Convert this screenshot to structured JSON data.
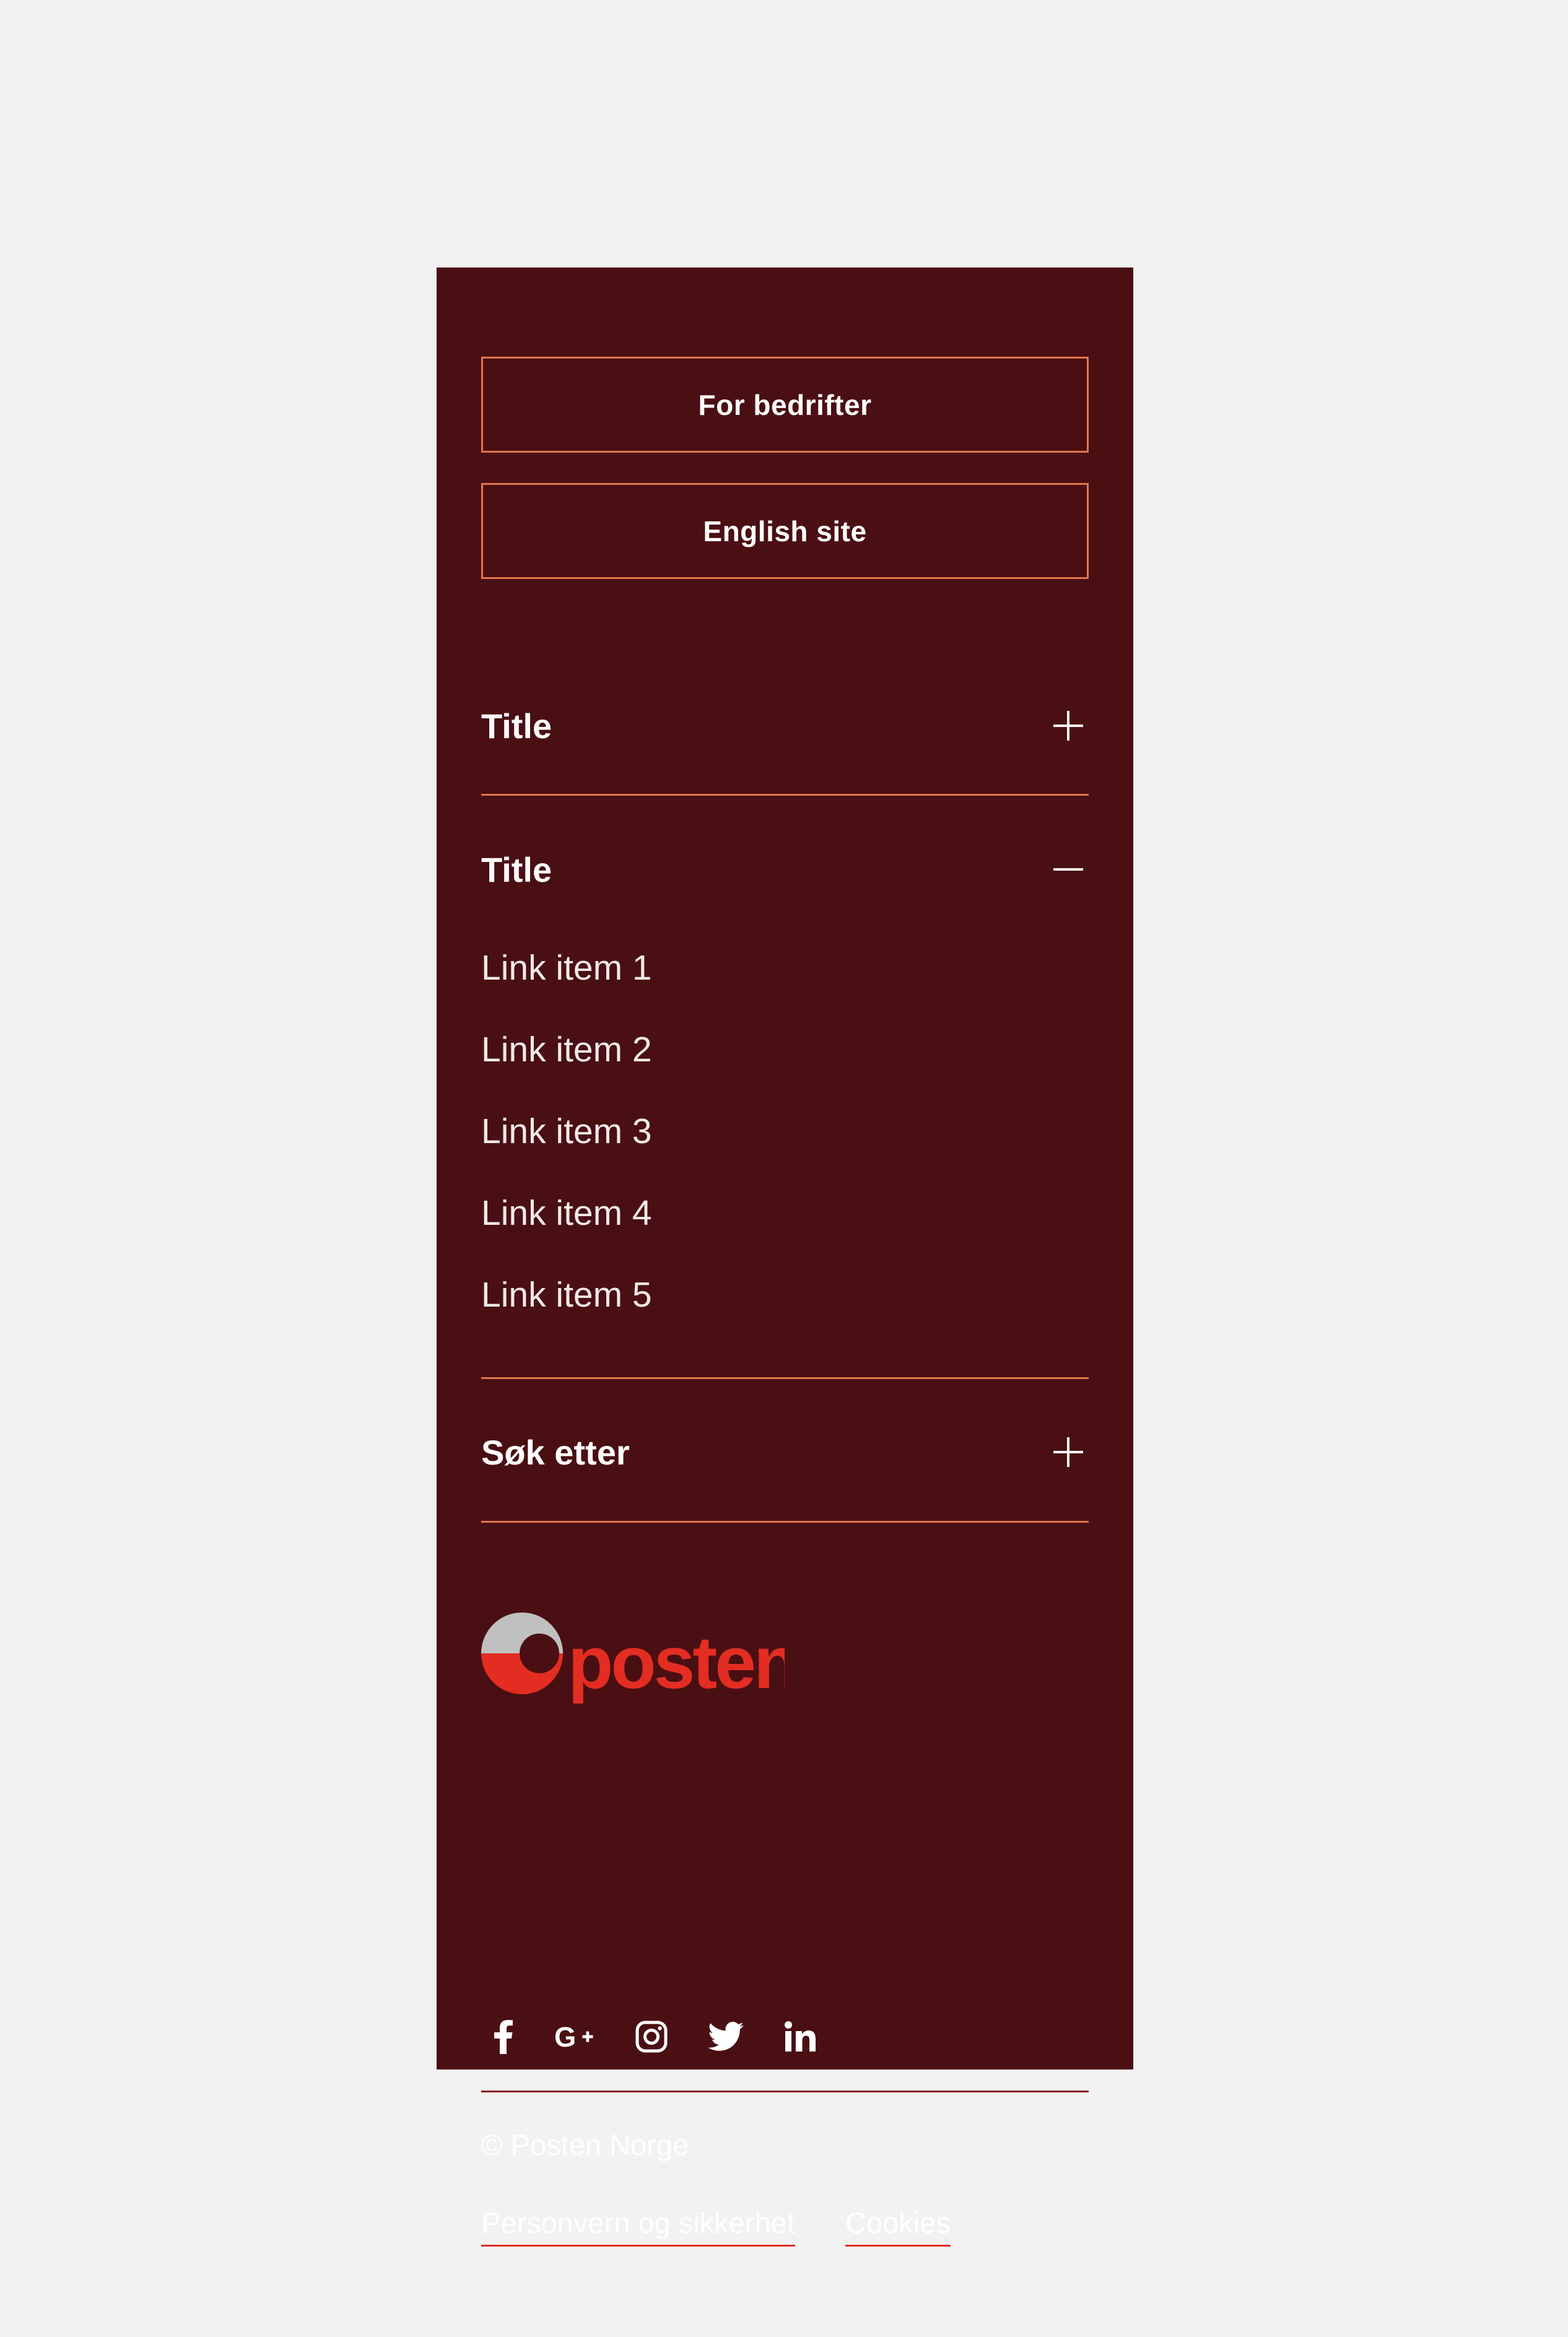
{
  "buttons": {
    "business": "For bedrifter",
    "english": "English site"
  },
  "accordions": [
    {
      "title": "Title",
      "state": "collapsed",
      "icon": "plus-icon"
    },
    {
      "title": "Title",
      "state": "expanded",
      "icon": "minus-icon",
      "links": [
        "Link item 1",
        "Link item 2",
        "Link item 3",
        "Link item 4",
        "Link item 5"
      ]
    },
    {
      "title": "Søk etter",
      "state": "collapsed",
      "icon": "plus-icon"
    }
  ],
  "logo": {
    "text": "posten",
    "colors": {
      "red": "#e32d22",
      "grey": "#c0c0c0"
    }
  },
  "social": [
    "facebook-icon",
    "google-plus-icon",
    "instagram-icon",
    "twitter-icon",
    "linkedin-icon"
  ],
  "copyright": "© Posten Norge",
  "bottom_links": [
    "Personvern og sikkerhet",
    "Cookies"
  ],
  "colors": {
    "background": "#4a0f12",
    "accent_border": "#e3764b",
    "link_underline": "#e32d22",
    "page": "#f2f2f2"
  }
}
